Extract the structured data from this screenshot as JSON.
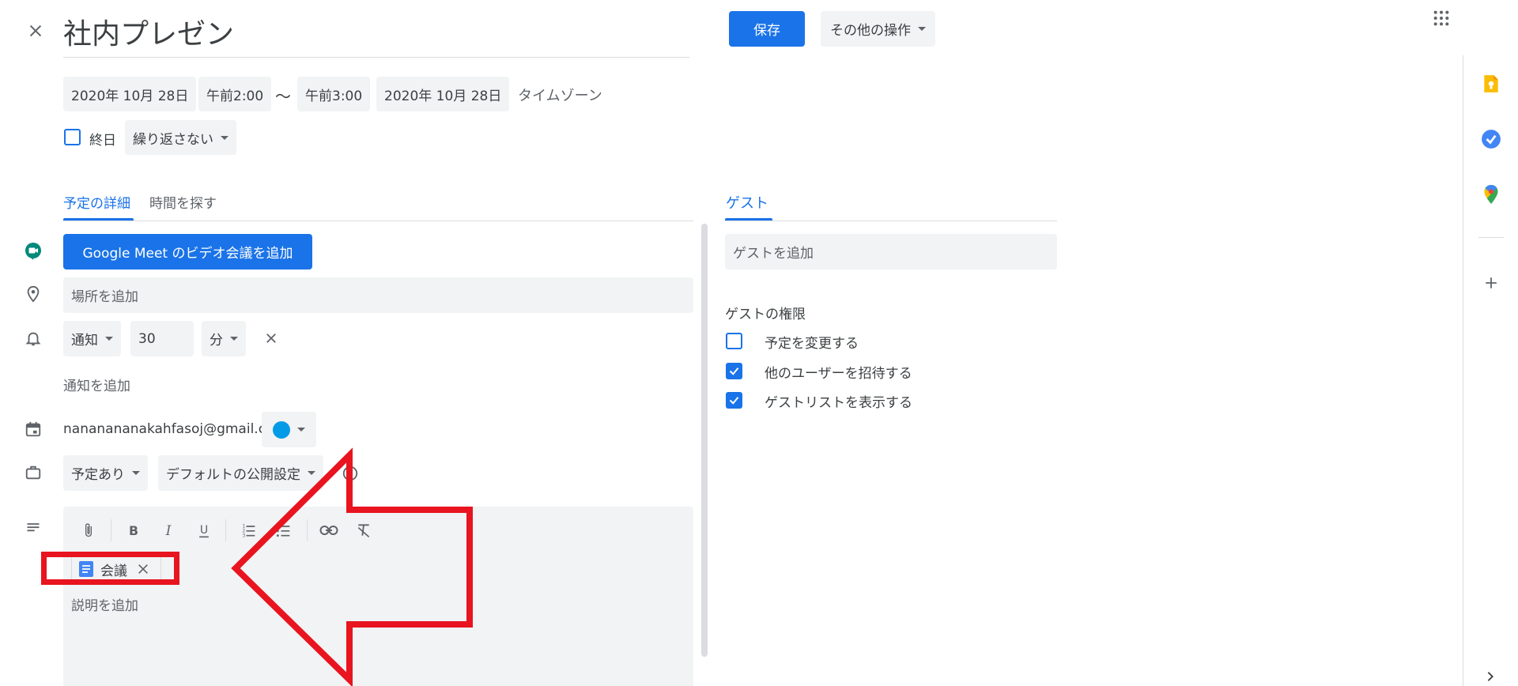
{
  "header": {
    "title": "社内プレゼン",
    "save_label": "保存",
    "more_actions_label": "その他の操作"
  },
  "datetime": {
    "start_date": "2020年 10月 28日",
    "start_time": "午前2:00",
    "separator": "〜",
    "end_time": "午前3:00",
    "end_date": "2020年 10月 28日",
    "timezone_label": "タイムゾーン",
    "all_day_label": "終日",
    "repeat_label": "繰り返さない"
  },
  "tabs": {
    "details": "予定の詳細",
    "find_time": "時間を探す",
    "guests": "ゲスト"
  },
  "details": {
    "meet_button": "Google Meet のビデオ会議を追加",
    "location_placeholder": "場所を追加",
    "notification_type": "通知",
    "notification_value": "30",
    "notification_unit": "分",
    "add_notification": "通知を追加",
    "calendar_owner": "nananananakahfasoj@gmail.com",
    "calendar_color": "#039be5",
    "availability": "予定あり",
    "visibility": "デフォルトの公開設定",
    "attachment_name": "会議",
    "description_placeholder": "説明を追加"
  },
  "guests": {
    "add_placeholder": "ゲストを追加",
    "permissions_title": "ゲストの権限",
    "permissions": [
      {
        "label": "予定を変更する",
        "checked": false
      },
      {
        "label": "他のユーザーを招待する",
        "checked": true
      },
      {
        "label": "ゲストリストを表示する",
        "checked": true
      }
    ]
  },
  "colors": {
    "accent": "#1a73e8",
    "annotation": "#e8141f",
    "field_bg": "#f1f3f4",
    "keep_yellow": "#fbbc04",
    "meet_green": "#00897b"
  },
  "icons": {
    "close": "close-icon",
    "apps": "apps-grid-icon",
    "meet": "google-meet-icon",
    "location": "location-pin-icon",
    "bell": "bell-icon",
    "calendar": "calendar-icon",
    "briefcase": "briefcase-icon",
    "description": "description-icon",
    "attachment": "paperclip-icon",
    "bold": "bold-icon",
    "italic": "italic-icon",
    "underline": "underline-icon",
    "numbered_list": "numbered-list-icon",
    "bulleted_list": "bulleted-list-icon",
    "link": "link-icon",
    "clear_format": "clear-format-icon",
    "doc": "google-docs-icon",
    "help": "help-icon",
    "keep": "keep-icon",
    "tasks": "tasks-icon",
    "maps": "maps-icon",
    "add": "add-icon",
    "chevron": "chevron-right-icon"
  }
}
